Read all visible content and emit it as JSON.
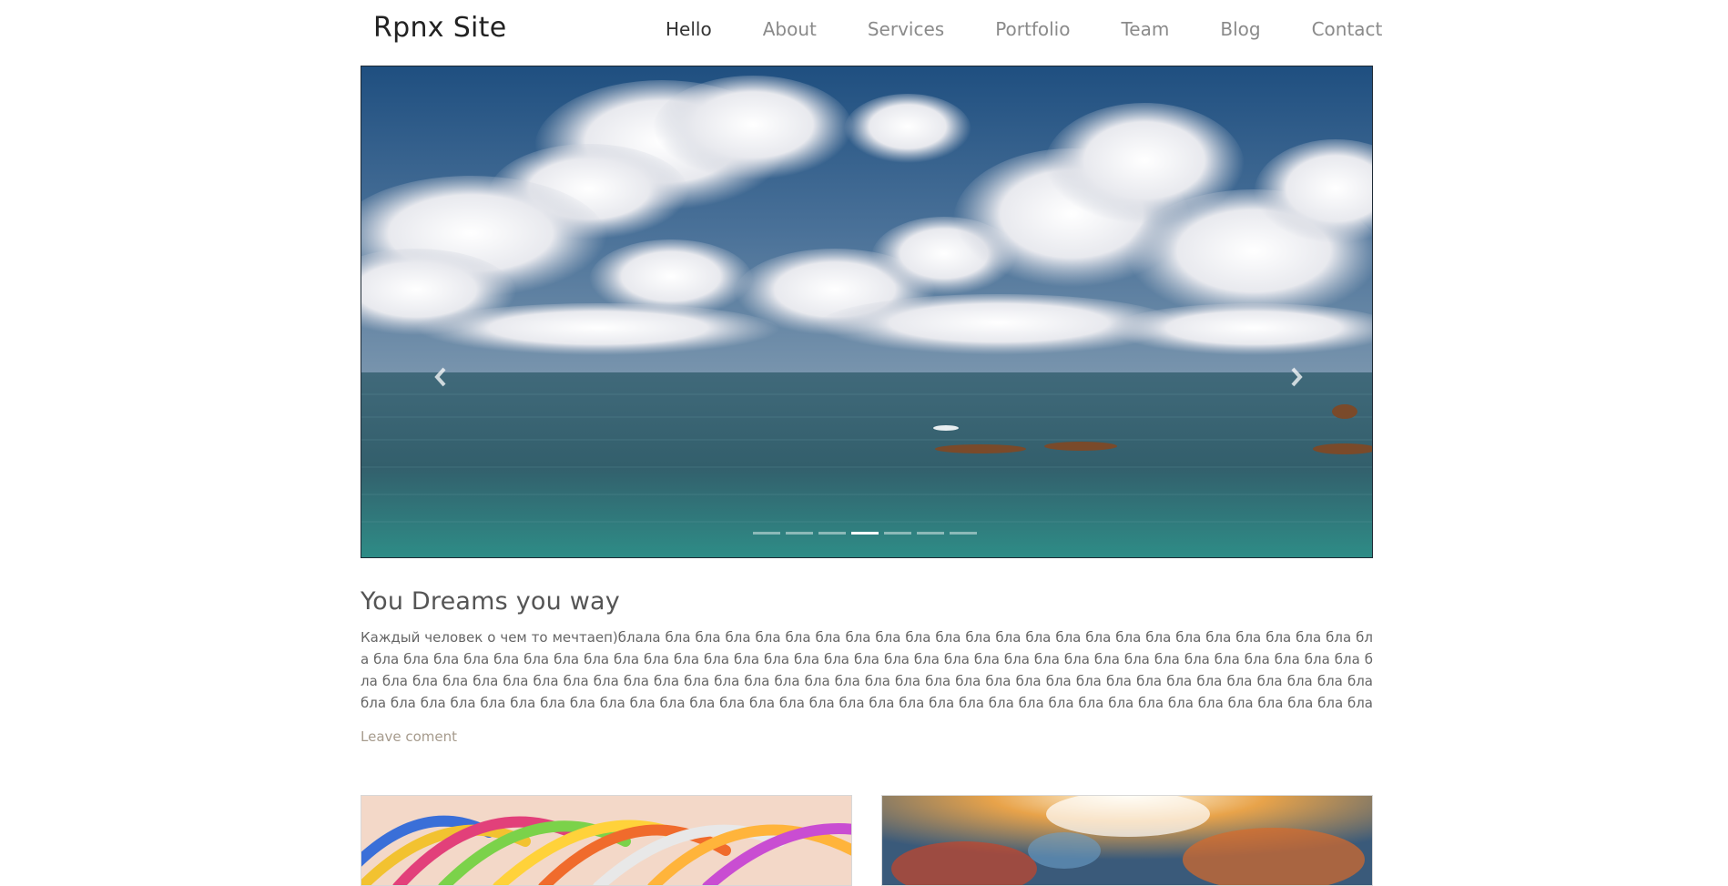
{
  "site": {
    "brand": "Rpnx Site"
  },
  "nav": {
    "items": [
      {
        "label": "Hello",
        "active": true
      },
      {
        "label": "About"
      },
      {
        "label": "Services"
      },
      {
        "label": "Portfolio"
      },
      {
        "label": "Team"
      },
      {
        "label": "Blog"
      },
      {
        "label": "Contact"
      }
    ]
  },
  "carousel": {
    "slide_count": 7,
    "active_index": 3,
    "prev_icon": "chevron-left-icon",
    "next_icon": "chevron-right-icon",
    "colors": {
      "sky_top": "#1f4f80",
      "sky_bottom": "#6f90ad",
      "sea_top": "#3d6a7a",
      "sea_bottom": "#2f8c88"
    }
  },
  "post": {
    "title": "You Dreams you way",
    "body": "Каждый человек о чем то мечтаеп)блала бла бла бла бла бла бла бла бла бла бла бла бла бла бла бла бла бла бла бла бла бла бла бла бла бла бла бла бла бла бла бла бла бла бла бла бла бла бла бла бла бла бла бла бла бла бла бла бла бла бла бла бла бла бла бла бла бла бла бла бла бла бла бла бла бла бла бла бла бла бла бла бла бла бла бла бла бла бла бла бла бла бла бла бла бла бла бла бла бла бла бла бла бла бла бла бла бла бла бла бла бла бла бла бла бла бла бла бла бла бла бла бла бла бла бла бла бла бла бла бла бла бла бла бла бла бла бла бла бла бла бла бла бла бла бла бла бла бла бла бла бла бла бла бла бла бла бла бла блаа fa",
    "leave_comment": "Leave coment",
    "link_color": "#a69b8d"
  }
}
